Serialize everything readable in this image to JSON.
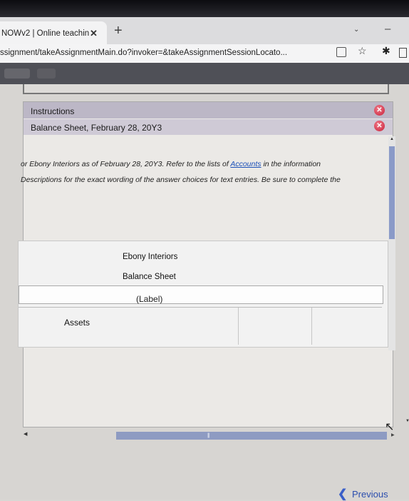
{
  "browser": {
    "tab_title": "NOWv2 | Online teachin",
    "tab_close": "✕",
    "new_tab": "+",
    "url": "ssignment/takeAssignmentMain.do?invoker=&takeAssignmentSessionLocato..."
  },
  "icons": {
    "share": "share-icon",
    "bookmark": "star-icon",
    "extensions": "puzzle-icon",
    "sidebar": "sidebar-icon",
    "close": "close-icon"
  },
  "instructions": {
    "header": "Instructions",
    "subheader": "Balance Sheet, February 28, 20Y3",
    "text_line1_pre": "or Ebony Interiors as of February 28, 20Y3. Refer to the lists of ",
    "text_link": "Accounts",
    "text_line1_post": " in the information",
    "text_line2": "Descriptions for the exact wording of the answer choices for text entries. Be sure to complete the"
  },
  "worksheet": {
    "company": "Ebony Interiors",
    "statement": "Balance Sheet",
    "label_placeholder": "(Label)",
    "rows": [
      {
        "label": "Assets"
      }
    ]
  },
  "navigation": {
    "previous_label": "Previous"
  },
  "colors": {
    "header_purple": "#bcb7c6",
    "link_blue": "#1a4fb8",
    "close_red": "#c8203a",
    "scroll_thumb": "#8e9bc2"
  }
}
